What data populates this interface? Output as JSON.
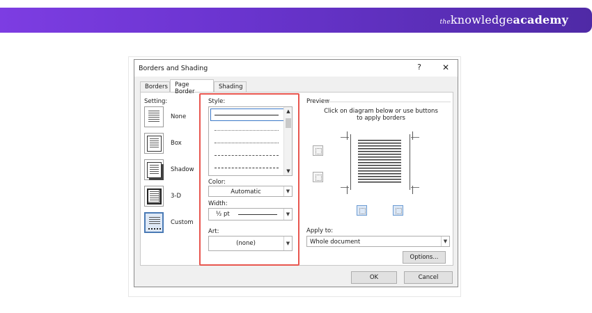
{
  "brand": {
    "prefix": "the",
    "main": "knowledge",
    "bold": "academy"
  },
  "dialog": {
    "title": "Borders and Shading",
    "help": "?",
    "close": "✕",
    "tabs": [
      {
        "label": "Borders"
      },
      {
        "label": "Page Border"
      },
      {
        "label": "Shading"
      }
    ],
    "setting": {
      "label": "Setting:",
      "items": [
        {
          "label": "None"
        },
        {
          "label": "Box"
        },
        {
          "label": "Shadow"
        },
        {
          "label": "3-D"
        },
        {
          "label": "Custom"
        }
      ]
    },
    "style": {
      "label": "Style:"
    },
    "color": {
      "label": "Color:",
      "value": "Automatic"
    },
    "width": {
      "label": "Width:",
      "value": "½ pt"
    },
    "art": {
      "label": "Art:",
      "value": "(none)"
    },
    "preview": {
      "label": "Preview",
      "hint_line1": "Click on diagram below or use buttons",
      "hint_line2": "to apply borders"
    },
    "apply_to": {
      "label": "Apply to:",
      "value": "Whole document"
    },
    "options_button": "Options...",
    "ok_button": "OK",
    "cancel_button": "Cancel"
  }
}
